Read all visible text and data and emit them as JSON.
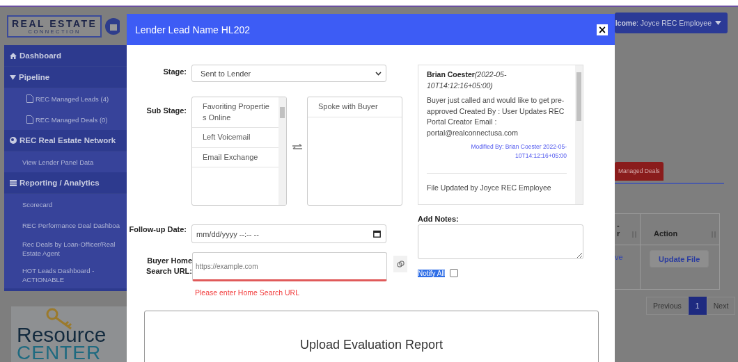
{
  "header": {
    "logo": {
      "line1": "REAL ESTATE",
      "line2": "CONNECTION"
    },
    "user_menu": "**lcome**: Joyce REC Employee"
  },
  "sidebar": {
    "items": [
      {
        "kind": "home",
        "label": "Dashboard"
      },
      {
        "kind": "group",
        "label": "Pipeline"
      },
      {
        "kind": "page",
        "label": "REC Managed Leads (4)"
      },
      {
        "kind": "page",
        "label": "REC Managed Deals (0)"
      },
      {
        "kind": "network",
        "label": "REC Real Estate Network"
      },
      {
        "kind": "link",
        "label": "View Lender Panel Data"
      },
      {
        "kind": "reports",
        "label": "Reporting / Analytics"
      },
      {
        "kind": "link",
        "label": "Scorecard"
      },
      {
        "kind": "link",
        "label": "REC Performance Deal Dashboa"
      },
      {
        "kind": "link",
        "label": "Rec Deals by Loan-Officer/Real Estate Agent"
      },
      {
        "kind": "link",
        "label": "HOT Leads Dashboard - ACTIONABLE"
      }
    ],
    "banner": {
      "line1": "Resource",
      "line2": "CENTER"
    }
  },
  "modal": {
    "title": "Lender Lead Name HL202",
    "close": "×",
    "stage": {
      "label": "Stage:",
      "value": "Sent to Lender"
    },
    "sub_stage": {
      "label": "Sub Stage:",
      "available": [
        "Favoriting Propertie s Online",
        "Left Voicemail",
        "Email Exchange"
      ],
      "chosen": [
        "Spoke with Buyer"
      ]
    },
    "notes": [
      {
        "kind": "note",
        "author": "Brian Coester",
        "time": "(2022-05-10T14:12:16+05:00)",
        "body": "Buyer just called and would like to get pre-approved Created By : User Updates REC Portal Creator Email : portal@realconnectusa.com",
        "modified": "Modified By: Brian Coester 2022-05-10T14:12:16+05:00"
      },
      {
        "kind": "plain",
        "body": "File Updated by Joyce REC Employee"
      }
    ],
    "follow_up": {
      "label": "Follow-up Date:",
      "placeholder": "mm/dd/yyyy --:-- --"
    },
    "home_url": {
      "label": "Buyer Home Search URL:",
      "placeholder": "https://example.com",
      "invalid": true,
      "error": "Please enter Home Search URL"
    },
    "add_notes": {
      "label": "Add Notes:"
    },
    "notify_all": {
      "label": "Notify All",
      "text_selected": true,
      "checked": false
    },
    "upload": {
      "title": "Upload Evaluation Report"
    }
  },
  "background": {
    "tab": {
      "label": "Managed Deals",
      "selected": true
    },
    "table": {
      "columns": [
        "-\nr",
        "Action"
      ],
      "rows": [
        {
          "cell": "ve",
          "button": "Update File"
        }
      ]
    },
    "pagination": {
      "previous": "Previous",
      "pages": [
        {
          "label": "1",
          "selected": true
        }
      ],
      "next": "Next"
    }
  }
}
